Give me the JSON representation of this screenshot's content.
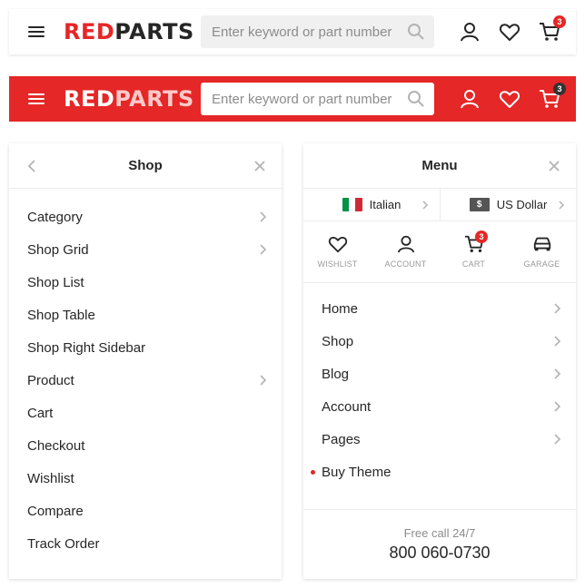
{
  "colors": {
    "accent": "#e52727",
    "text": "#262626",
    "muted": "#8c8c8c"
  },
  "header_light": {
    "logo_part1": "RED",
    "logo_part2": "PARTS",
    "search_placeholder": "Enter keyword or part number",
    "cart_count": "3",
    "icons": [
      "menu-icon",
      "search-icon",
      "account-icon",
      "heart-icon",
      "cart-icon"
    ]
  },
  "header_red": {
    "logo_part1": "RED",
    "logo_part2": "PARTS",
    "search_placeholder": "Enter keyword or part number",
    "cart_count": "3"
  },
  "shop_panel": {
    "title": "Shop",
    "items": [
      {
        "label": "Category",
        "has_submenu": true
      },
      {
        "label": "Shop Grid",
        "has_submenu": true
      },
      {
        "label": "Shop List",
        "has_submenu": false
      },
      {
        "label": "Shop Table",
        "has_submenu": false
      },
      {
        "label": "Shop Right Sidebar",
        "has_submenu": false
      },
      {
        "label": "Product",
        "has_submenu": true
      },
      {
        "label": "Cart",
        "has_submenu": false
      },
      {
        "label": "Checkout",
        "has_submenu": false
      },
      {
        "label": "Wishlist",
        "has_submenu": false
      },
      {
        "label": "Compare",
        "has_submenu": false
      },
      {
        "label": "Track Order",
        "has_submenu": false
      }
    ]
  },
  "menu_panel": {
    "title": "Menu",
    "language": "Italian",
    "currency": "US Dollar",
    "currency_symbol": "$",
    "indicators": [
      {
        "label": "Wishlist",
        "icon": "heart-icon"
      },
      {
        "label": "Account",
        "icon": "account-icon"
      },
      {
        "label": "Cart",
        "icon": "cart-icon",
        "badge": "3"
      },
      {
        "label": "Garage",
        "icon": "car-icon"
      }
    ],
    "items": [
      {
        "label": "Home",
        "has_submenu": true
      },
      {
        "label": "Shop",
        "has_submenu": true
      },
      {
        "label": "Blog",
        "has_submenu": true
      },
      {
        "label": "Account",
        "has_submenu": true
      },
      {
        "label": "Pages",
        "has_submenu": true
      },
      {
        "label": "Buy Theme",
        "has_submenu": false,
        "highlight": true
      }
    ],
    "contacts_title": "Free call 24/7",
    "contacts_phone": "800 060-0730"
  }
}
